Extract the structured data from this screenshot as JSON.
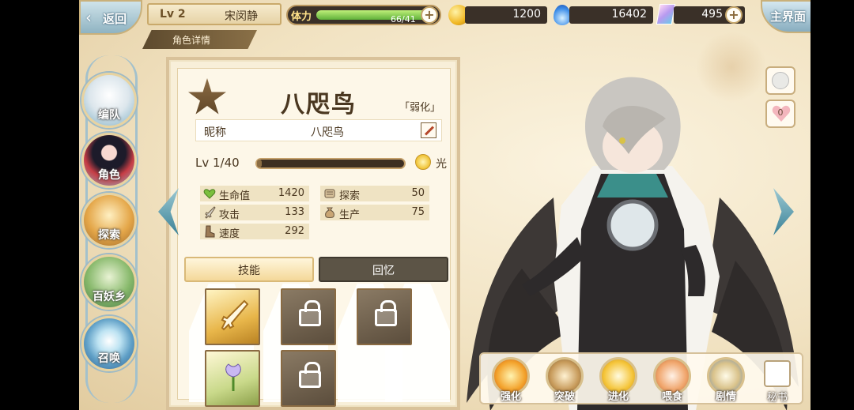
{
  "topbar": {
    "back_label": "返回",
    "level": "Lv 2",
    "player_name": "宋闵静",
    "detail_tab": "角色详情",
    "stamina_label": "体力",
    "stamina_value": "66/41",
    "stamina_fill_fraction": 1.0,
    "gold": "1200",
    "spirit": "16402",
    "crystal": "495",
    "home_label": "主界面"
  },
  "sidebar": {
    "items": [
      {
        "label": "编队",
        "icon": "team-icon"
      },
      {
        "label": "角色",
        "icon": "character-icon"
      },
      {
        "label": "探索",
        "icon": "explore-icon"
      },
      {
        "label": "百妖乡",
        "icon": "village-icon"
      },
      {
        "label": "召唤",
        "icon": "summon-icon"
      }
    ]
  },
  "character": {
    "name": "八咫鸟",
    "status": "「弱化」",
    "nickname_label": "昵称",
    "nickname": "八咫鸟",
    "level": "Lv  1/40",
    "level_fill_fraction": 0.02,
    "element": "光",
    "stats": {
      "hp_label": "生命值",
      "hp": "1420",
      "atk_label": "攻击",
      "atk": "133",
      "spd_label": "速度",
      "spd": "292",
      "explore_label": "探索",
      "explore": "50",
      "produce_label": "生产",
      "produce": "75"
    }
  },
  "tabs": {
    "skill": "技能",
    "memory": "回忆"
  },
  "actions": {
    "enhance": "强化",
    "breakthrough": "突破",
    "evolve": "进化",
    "feed": "喂食",
    "story": "剧情",
    "secret": "秘书"
  },
  "mini": {
    "affection": "0"
  },
  "colors": {
    "accent": "#c9a96b",
    "panel": "#f8efd9",
    "stamina_fill": "#5fb13a"
  }
}
